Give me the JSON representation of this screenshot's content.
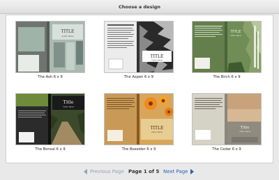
{
  "window": {
    "title": "Choose a design"
  },
  "designs": [
    {
      "name": "The Ash 6 x 9",
      "cover_title": "TITLE",
      "cover_subtitle": "Author Name"
    },
    {
      "name": "The Aspen 6 x 9",
      "cover_title": "TITLE",
      "cover_subtitle": "Author Name"
    },
    {
      "name": "The Birch 6 x 9",
      "cover_title": "TITLE",
      "cover_subtitle": "Author Name"
    },
    {
      "name": "The Bonsai 6 x 9",
      "cover_title": "Title",
      "cover_subtitle": "Author Name"
    },
    {
      "name": "The Boxelder 6 x 9",
      "cover_title": "TITLE",
      "cover_subtitle": "Author Name"
    },
    {
      "name": "The Cedar 6 x 9",
      "cover_title": "Title",
      "cover_subtitle": "Author Name"
    }
  ],
  "pager": {
    "previous_label": "Previous Page",
    "page_info": "Page 1 of 5",
    "next_label": "Next Page"
  },
  "colors": {
    "link": "#2563b0",
    "disabled": "#9aa0a8"
  }
}
